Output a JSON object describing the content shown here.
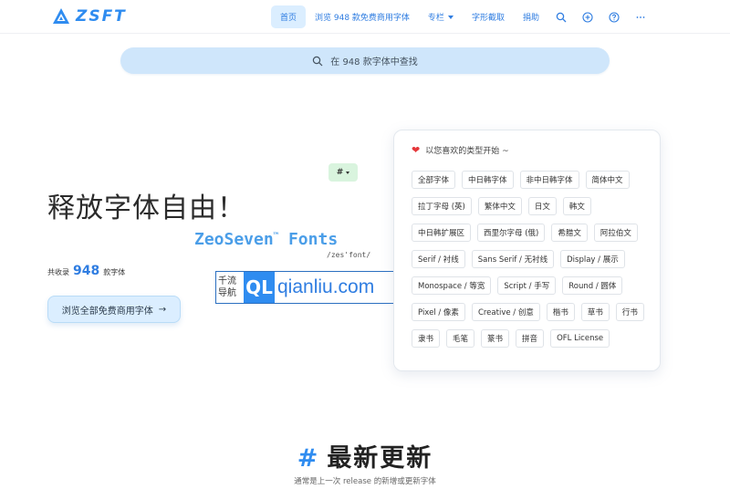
{
  "navbar": {
    "logo_text": "ZSFT",
    "items": [
      {
        "label": "首页",
        "active": true
      },
      {
        "label": "浏览 948 款免费商用字体"
      },
      {
        "label": "专栏",
        "dropdown": true
      },
      {
        "label": "字形截取"
      },
      {
        "label": "捐助"
      }
    ],
    "icons": [
      "search-icon",
      "plus-circle-icon",
      "help-circle-icon",
      "more-icon"
    ]
  },
  "search": {
    "placeholder": "在 948 款字体中查找"
  },
  "hero": {
    "title": "释放字体自由！",
    "hash_chip": "#",
    "brand": "ZeoSeven",
    "brand_tm": "™",
    "brand_fonts": "Fonts",
    "brand_sub": "/zes'font/",
    "count_prefix": "共收录",
    "count_value": "948",
    "count_suffix": "款字体",
    "browse_button": "浏览全部免费商用字体",
    "browse_arrow": "→"
  },
  "watermark": {
    "cn_line1": "千流",
    "cn_line2": "导航",
    "badge": "QL",
    "domain": "qianliu.com"
  },
  "categories": {
    "heading": "以您喜欢的类型开始 ~",
    "tags": [
      "全部字体",
      "中日韩字体",
      "非中日韩字体",
      "简体中文",
      "拉丁字母 (英)",
      "繁体中文",
      "日文",
      "韩文",
      "中日韩扩展区",
      "西里尔字母 (俄)",
      "希腊文",
      "阿拉伯文",
      "Serif / 衬线",
      "Sans Serif / 无衬线",
      "Display / 展示",
      "Monospace / 等宽",
      "Script / 手写",
      "Round / 圆体",
      "Pixel / 像素",
      "Creative / 创意",
      "楷书",
      "草书",
      "行书",
      "隶书",
      "毛笔",
      "篆书",
      "拼音",
      "OFL License"
    ]
  },
  "latest": {
    "hash": "#",
    "title": "最新更新",
    "subtitle": "通常是上一次 release 的新增或更新字体"
  },
  "colors": {
    "accent": "#2f8cf0",
    "nav_active_bg": "#dbeeff",
    "search_bg": "#cfe6fb",
    "chip_bg": "#d9f4de"
  }
}
